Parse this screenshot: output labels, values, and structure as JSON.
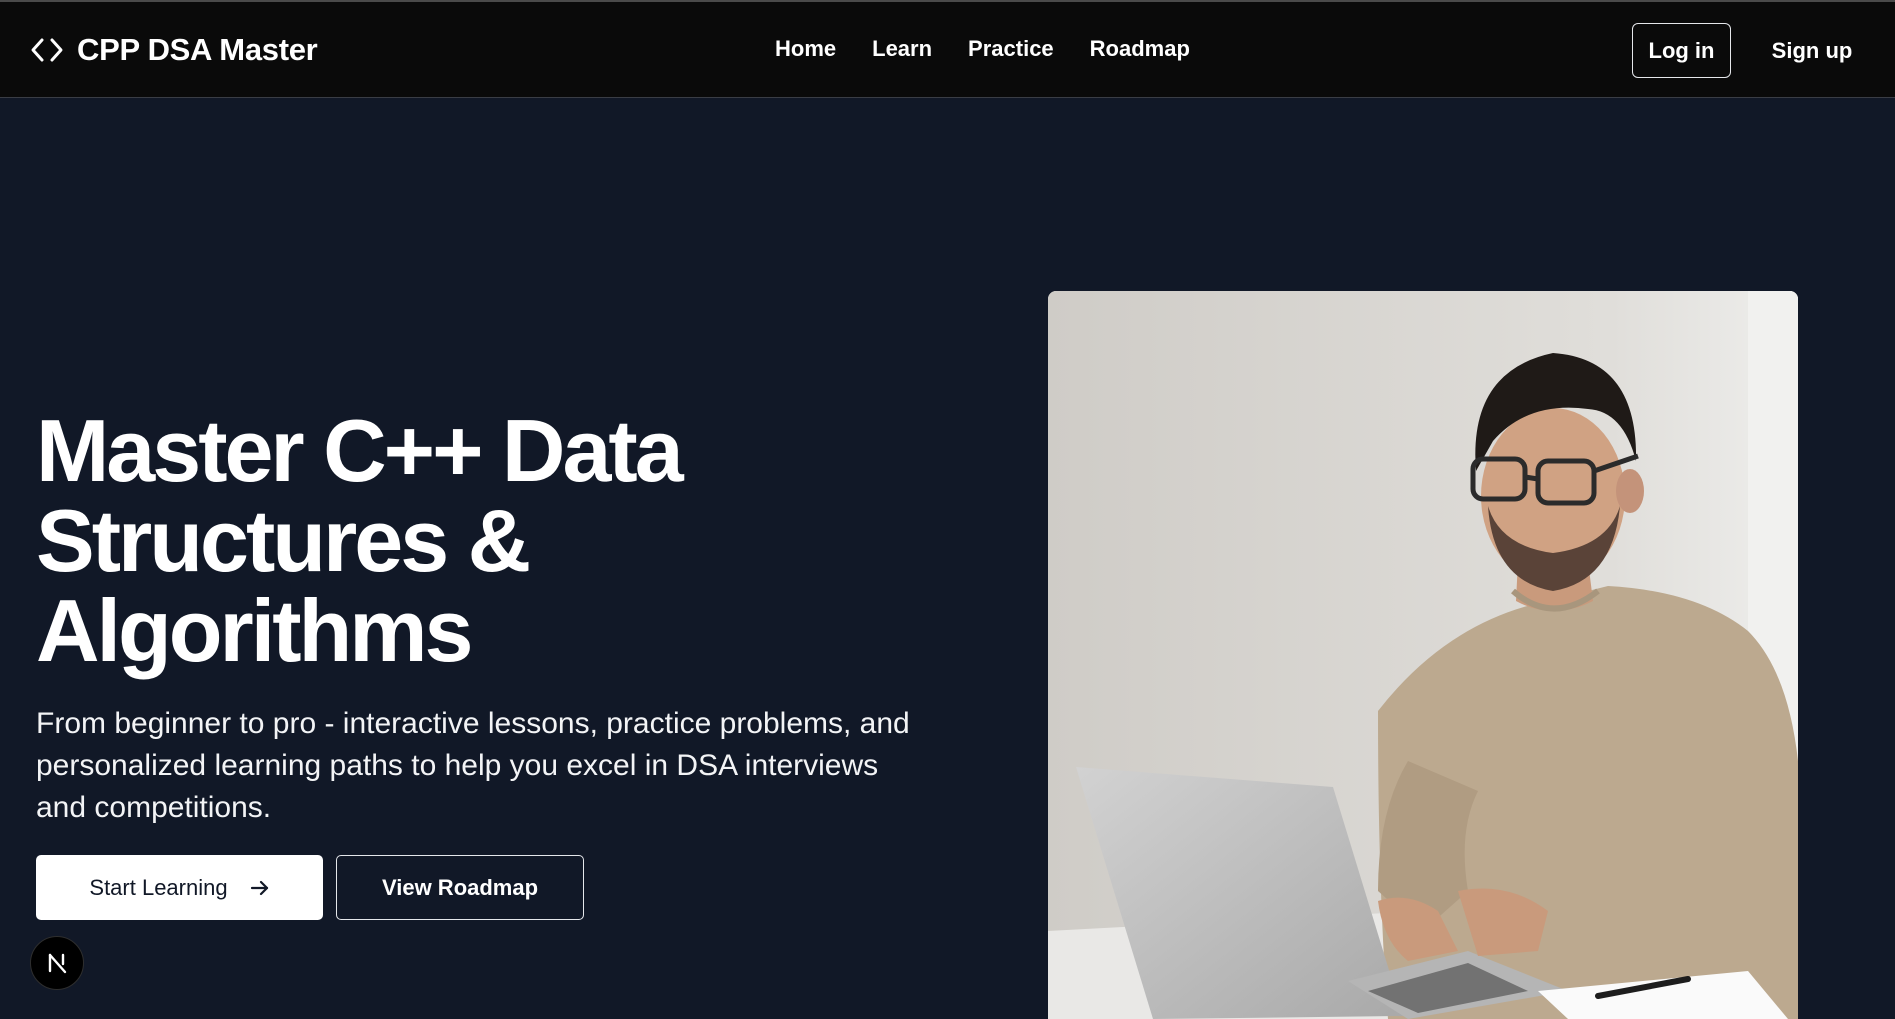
{
  "nav": {
    "brand": "CPP DSA Master",
    "brand_icon": "code-brackets-icon",
    "links": [
      "Home",
      "Learn",
      "Practice",
      "Roadmap"
    ],
    "login_label": "Log in",
    "signup_label": "Sign up"
  },
  "hero": {
    "title": "Master C++ Data Structures & Algorithms",
    "subtitle": "From beginner to pro - interactive lessons, practice problems, and personalized learning paths to help you excel in DSA interviews and competitions.",
    "primary_cta": "Start Learning",
    "primary_cta_icon": "arrow-right-icon",
    "secondary_cta": "View Roadmap",
    "image_alt": "man with glasses typing on a laptop"
  },
  "dev_badge": {
    "label": "N"
  },
  "colors": {
    "background": "#111827",
    "navbar": "#0a0a0a",
    "text": "#ffffff"
  }
}
